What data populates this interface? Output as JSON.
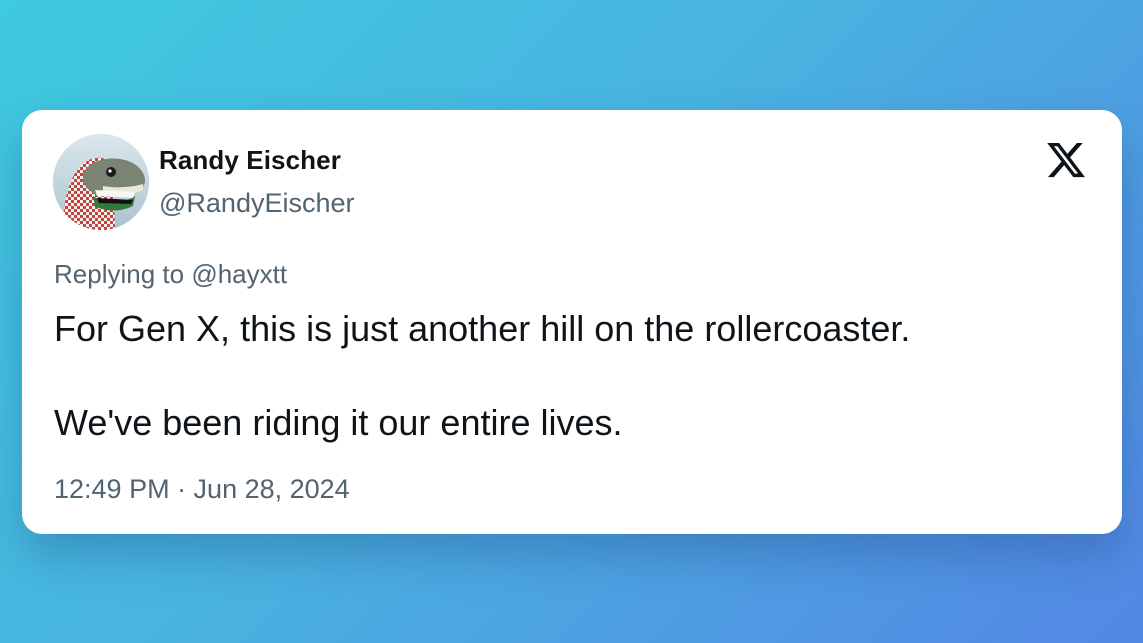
{
  "tweet": {
    "author": {
      "name": "Randy Eischer",
      "handle": "@RandyEischer",
      "avatar_icon": "dinosaur-keffiyeh-avatar"
    },
    "platform_icon": "x-logo-icon",
    "reply": {
      "prefix": "Replying to ",
      "handle": "@hayxtt"
    },
    "text_lines": [
      "For Gen X, this is just another hill on the rollercoaster.",
      "We've been riding it our entire lives."
    ],
    "timestamp": "12:49 PM · Jun 28, 2024"
  },
  "colors": {
    "background_start": "#3ecadf",
    "background_end": "#5387e4",
    "card": "#ffffff",
    "primary_text": "#0f1419",
    "secondary_text": "#536471"
  }
}
